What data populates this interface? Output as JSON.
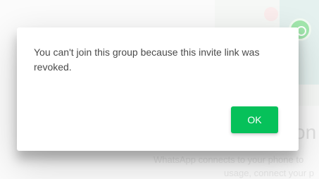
{
  "dialog": {
    "message": "You can't join this group because this invite link was revoked.",
    "ok_label": "OK"
  },
  "background": {
    "heading_fragment": "on",
    "body_line_1": "WhatsApp connects to your phone to",
    "body_line_2": "usage, connect your p",
    "logo_icon": "whatsapp-logo-icon"
  },
  "colors": {
    "accent": "#06c15a",
    "message_text": "#4a4a4a",
    "logo": "#56d46a"
  }
}
